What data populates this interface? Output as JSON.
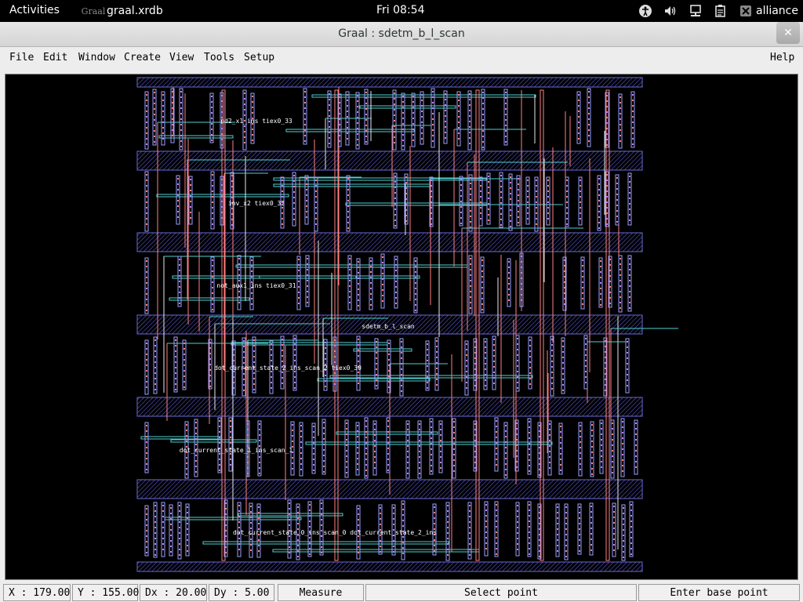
{
  "topbar": {
    "activities": "Activities",
    "app_name": "graal.xrdb",
    "app_icon_text": "Graal",
    "clock": "Fri 08:54",
    "user": "alliance",
    "icons": [
      "accessibility-icon",
      "volume-icon",
      "network-icon",
      "clipboard-icon",
      "user-x-icon"
    ]
  },
  "window": {
    "title": "Graal : sdetm_b_l_scan",
    "close_glyph": "✕"
  },
  "menu": {
    "items": [
      {
        "label": "File"
      },
      {
        "label": "Edit"
      },
      {
        "label": "Window"
      },
      {
        "label": "Create"
      },
      {
        "label": "View"
      },
      {
        "label": "Tools"
      },
      {
        "label": "Setup"
      }
    ],
    "help": "Help"
  },
  "layout": {
    "cell_name": "sdetm_b_l_scan",
    "row_labels": [
      "nd2_x1_ins  tiex0_33",
      "inv_x2  tiex0_32",
      "not_aux1_ins  tiex0_31",
      "dot_current_state_2_ins_scan_2  tiex0_30",
      "dot_current_state_1_ins_scan_1",
      "dot_current_state_0_ins_scan_0  dot_current_state_2_ins"
    ],
    "colors": {
      "rail": "#6a6ad8",
      "poly": "#ff8080",
      "metal1": "#4fd0d0",
      "metal2": "#e8e8e8",
      "via": "#9aa0ff"
    }
  },
  "status": {
    "x": "X : 179.00",
    "y": "Y : 155.00",
    "dx": "Dx : 20.00",
    "dy": "Dy : 5.00",
    "mode": "Measure",
    "prompt": "Select point",
    "hint": "Enter base point"
  }
}
